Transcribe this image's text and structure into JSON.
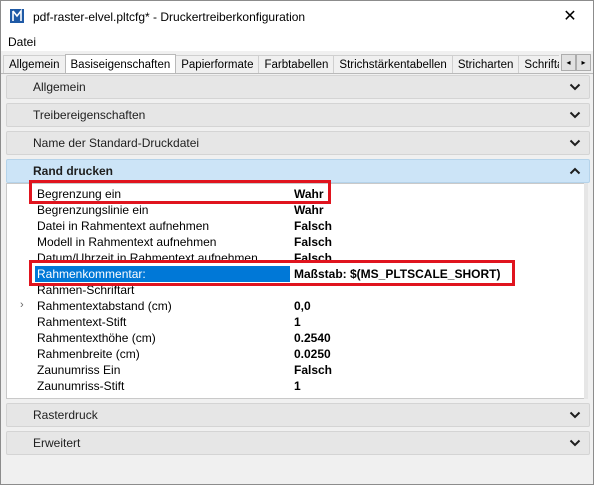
{
  "window": {
    "title": "pdf-raster-elvel.pltcfg* - Druckertreiberkonfiguration",
    "close_glyph": "✕",
    "icon": "app-printer-icon"
  },
  "menu": {
    "items": [
      "Datei"
    ]
  },
  "tabs": {
    "items": [
      "Allgemein",
      "Basiseigenschaften",
      "Papierformate",
      "Farbtabellen",
      "Strichstärkentabellen",
      "Stricharten",
      "Schriftartzuord"
    ],
    "active_index": 1,
    "scroll_left": "◂",
    "scroll_right": "▸"
  },
  "sections": {
    "allgemein": "Allgemein",
    "treibereigenschaften": "Treibereigenschaften",
    "standard_druckdatei": "Name der Standard-Druckdatei",
    "rand_drucken": "Rand drucken",
    "rasterdruck": "Rasterdruck",
    "erweitert": "Erweitert"
  },
  "properties": [
    {
      "name": "Begrenzung ein",
      "value": "Wahr"
    },
    {
      "name": "Begrenzungslinie ein",
      "value": "Wahr"
    },
    {
      "name": "Datei in Rahmentext aufnehmen",
      "value": "Falsch"
    },
    {
      "name": "Modell in Rahmentext aufnehmen",
      "value": "Falsch"
    },
    {
      "name": "Datum/Uhrzeit in Rahmentext aufnehmen",
      "value": "Falsch"
    },
    {
      "name": "Rahmenkommentar:",
      "value": "Maßstab: $(MS_PLTSCALE_SHORT)"
    },
    {
      "name": "Rahmen-Schriftart",
      "value": ""
    },
    {
      "name": "Rahmentextabstand (cm)",
      "value": "0,0"
    },
    {
      "name": "Rahmentext-Stift",
      "value": "1"
    },
    {
      "name": "Rahmentexthöhe (cm)",
      "value": "0.2540"
    },
    {
      "name": "Rahmenbreite (cm)",
      "value": "0.0250"
    },
    {
      "name": "Zaunumriss Ein",
      "value": "Falsch"
    },
    {
      "name": "Zaunumriss-Stift",
      "value": "1"
    }
  ],
  "expander_glyph": "›",
  "colors": {
    "selection": "#0078d7",
    "highlight_box": "#e0141e",
    "open_section": "#cce4f7"
  }
}
